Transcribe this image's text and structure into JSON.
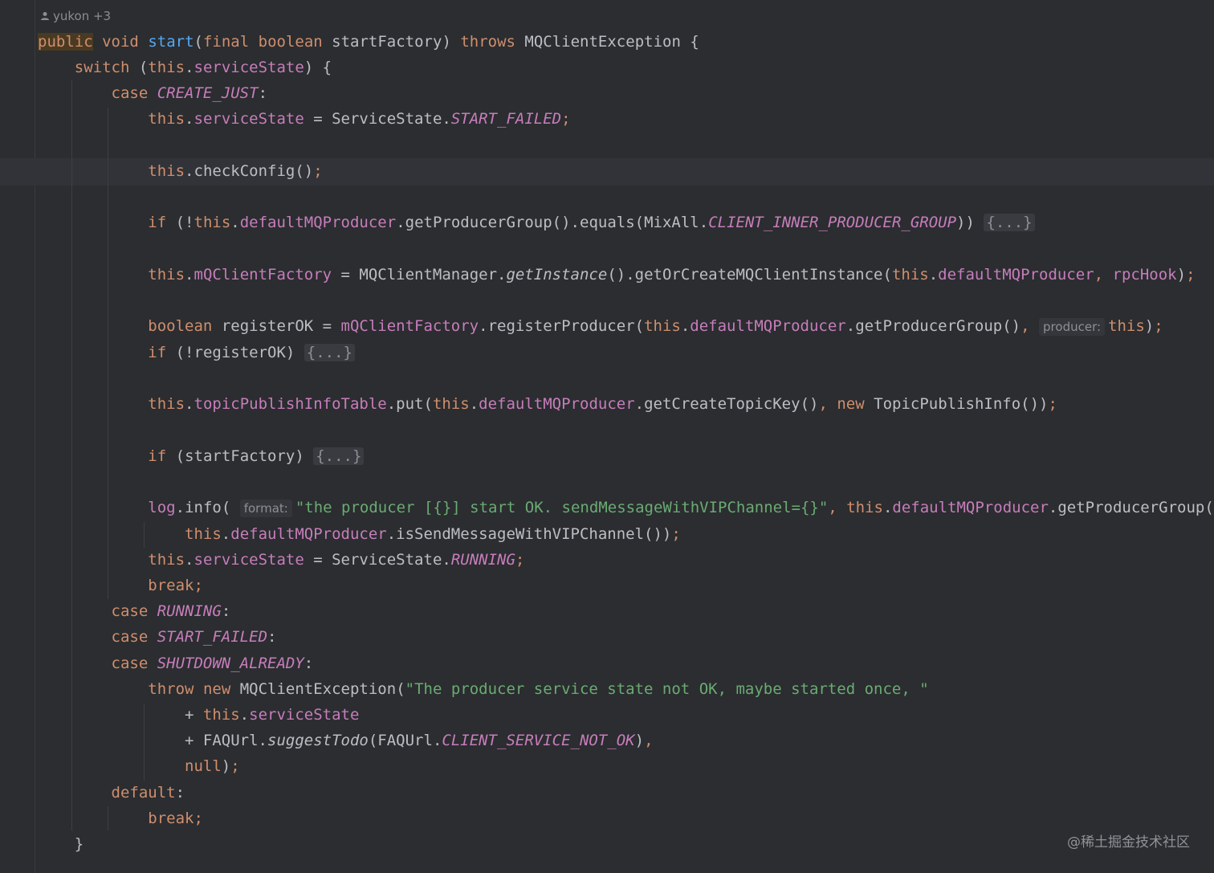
{
  "author": {
    "name": "yukon +3",
    "icon": "person-icon"
  },
  "code": {
    "l_public": "public",
    "l_void": "void",
    "l_start": "start",
    "l_final": "final",
    "l_boolean": "boolean",
    "l_startFactory": "startFactory",
    "l_throws": "throws",
    "l_MQClientException": "MQClientException",
    "l_switch": "switch",
    "l_this": "this",
    "l_serviceState": "serviceState",
    "l_case": "case",
    "l_CREATE_JUST": "CREATE_JUST",
    "l_ServiceState": "ServiceState",
    "l_START_FAILED": "START_FAILED",
    "l_checkConfig": "checkConfig",
    "l_if": "if",
    "l_defaultMQProducer": "defaultMQProducer",
    "l_getProducerGroup": "getProducerGroup",
    "l_equals": "equals",
    "l_MixAll": "MixAll",
    "l_CLIENT_INNER_PRODUCER_GROUP": "CLIENT_INNER_PRODUCER_GROUP",
    "l_fold": "{...}",
    "l_mQClientFactory": "mQClientFactory",
    "l_MQClientManager": "MQClientManager",
    "l_getInstance": "getInstance",
    "l_getOrCreateMQClientInstance": "getOrCreateMQClientInstance",
    "l_rpcHook": "rpcHook",
    "l_registerOK": "registerOK",
    "l_registerProducer": "registerProducer",
    "l_hint_producer": "producer:",
    "l_topicPublishInfoTable": "topicPublishInfoTable",
    "l_put": "put",
    "l_getCreateTopicKey": "getCreateTopicKey",
    "l_new": "new",
    "l_TopicPublishInfo": "TopicPublishInfo",
    "l_log": "log",
    "l_info": "info",
    "l_hint_format": "format:",
    "l_str_log": "\"the producer [{}] start OK. sendMessageWithVIPChannel={}\"",
    "l_isSendMessageWithVIPChannel": "isSendMessageWithVIPChannel",
    "l_RUNNING": "RUNNING",
    "l_break": "break",
    "l_SHUTDOWN_ALREADY": "SHUTDOWN_ALREADY",
    "l_throw": "throw",
    "l_str_exc": "\"The producer service state not OK, maybe started once, \"",
    "l_FAQUrl": "FAQUrl",
    "l_suggestTodo": "suggestTodo",
    "l_CLIENT_SERVICE_NOT_OK": "CLIENT_SERVICE_NOT_OK",
    "l_null": "null",
    "l_default": "default"
  },
  "watermark": "@稀土掘金技术社区"
}
